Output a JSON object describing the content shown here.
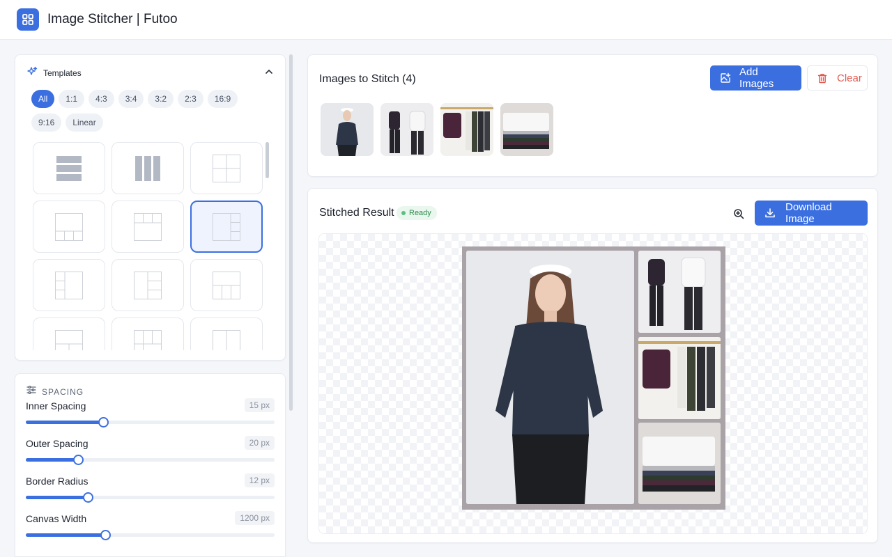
{
  "header": {
    "title": "Image Stitcher | Futoo",
    "logo_icon": "grid-icon"
  },
  "templates": {
    "title": "Templates",
    "filters": [
      "All",
      "1:1",
      "4:3",
      "3:4",
      "3:2",
      "2:3",
      "16:9",
      "9:16",
      "Linear"
    ],
    "active_filter": "All",
    "selected_index": 5
  },
  "spacing": {
    "title": "SPACING",
    "sliders": [
      {
        "label": "Inner Spacing",
        "value": "15 px",
        "fraction": 0.31
      },
      {
        "label": "Outer Spacing",
        "value": "20 px",
        "fraction": 0.21
      },
      {
        "label": "Border Radius",
        "value": "12 px",
        "fraction": 0.25
      },
      {
        "label": "Canvas Width",
        "value": "1200 px",
        "fraction": 0.32
      }
    ]
  },
  "images": {
    "title": "Images to Stitch (4)",
    "add_label": "Add Images",
    "clear_label": "Clear"
  },
  "result": {
    "title": "Stitched Result",
    "status": "Ready",
    "download_label": "Download Image"
  },
  "colors": {
    "accent": "#3b6fe0",
    "danger": "#e05a4f",
    "success": "#2f8a4c"
  }
}
